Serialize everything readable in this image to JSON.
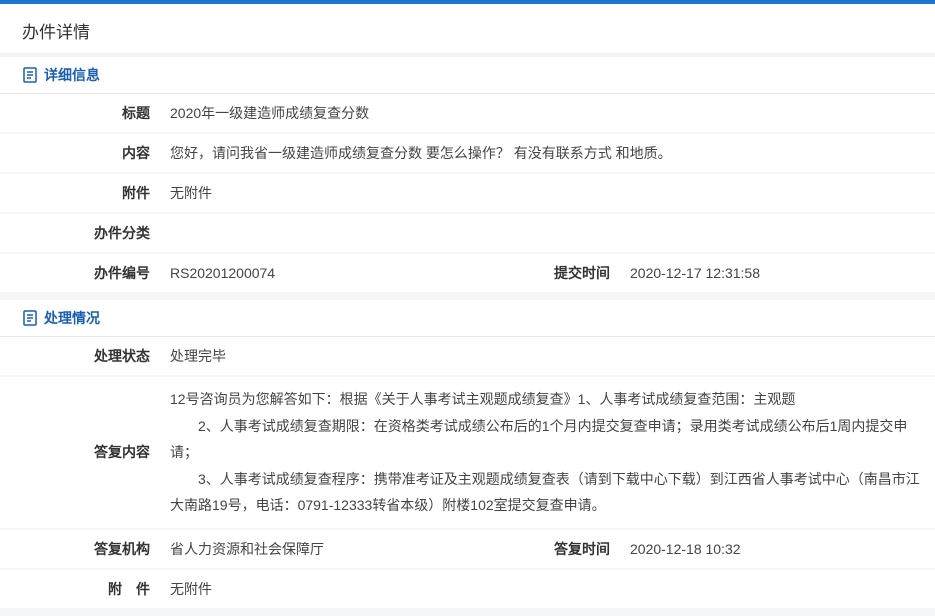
{
  "pageTitle": "办件详情",
  "detail": {
    "sectionTitle": "详细信息",
    "rows": {
      "title": {
        "label": "标题",
        "value": "2020年一级建造师成绩复查分数"
      },
      "content": {
        "label": "内容",
        "value": "您好，请问我省一级建造师成绩复查分数 要怎么操作？ 有没有联系方式 和地质。"
      },
      "attachment": {
        "label": "附件",
        "value": "无附件"
      },
      "category": {
        "label": "办件分类",
        "value": ""
      },
      "caseNo": {
        "label": "办件编号",
        "value": "RS20201200074"
      },
      "submitTime": {
        "label": "提交时间",
        "value": "2020-12-17 12:31:58"
      }
    }
  },
  "process": {
    "sectionTitle": "处理情况",
    "rows": {
      "status": {
        "label": "处理状态",
        "value": "处理完毕"
      },
      "replyContent": {
        "label": "答复内容",
        "paragraphs": [
          "12号咨询员为您解答如下：根据《关于人事考试主观题成绩复查》1、人事考试成绩复查范围：主观题",
          "2、人事考试成绩复查期限：在资格类考试成绩公布后的1个月内提交复查申请；录用类考试成绩公布后1周内提交申请；",
          "3、人事考试成绩复查程序：携带准考证及主观题成绩复查表（请到下载中心下载）到江西省人事考试中心（南昌市江大南路19号，电话：0791-12333转省本级）附楼102室提交复查申请。"
        ]
      },
      "replyOrg": {
        "label": "答复机构",
        "value": "省人力资源和社会保障厅"
      },
      "replyTime": {
        "label": "答复时间",
        "value": "2020-12-18 10:32"
      },
      "attachment": {
        "label": "附　件",
        "value": "无附件"
      }
    }
  },
  "colors": {
    "accent": "#1a5fb4",
    "topBar": "#1976d2",
    "bg": "#f5f6f7"
  }
}
